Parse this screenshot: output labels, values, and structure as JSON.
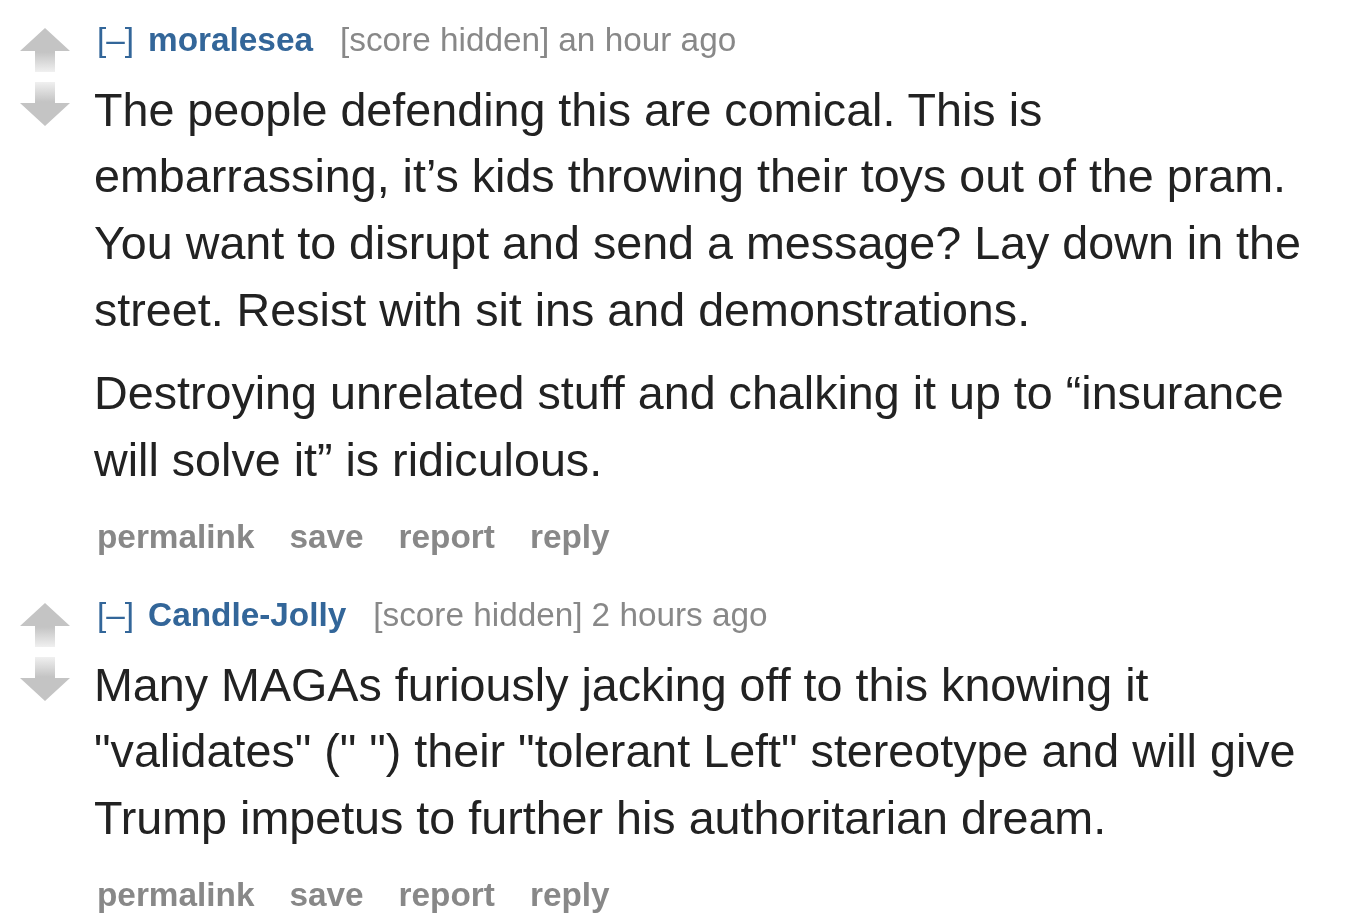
{
  "comments": [
    {
      "upvoted": false,
      "downvoted": false,
      "collapse_toggle": "[–]",
      "author": "moralesea",
      "score": "[score hidden]",
      "time": "an hour ago",
      "paragraphs": [
        "The people defending this are comical. This is embarrassing, it’s kids throwing their toys out of the pram. You want to disrupt and send a message? Lay down in the street. Resist with sit ins and demonstrations.",
        "Destroying unrelated stuff and chalking it up to “insurance will solve it” is ridiculous."
      ],
      "actions": [
        "permalink",
        "save",
        "report",
        "reply"
      ]
    },
    {
      "upvoted": false,
      "downvoted": false,
      "collapse_toggle": "[–]",
      "author": "Candle-Jolly",
      "score": "[score hidden]",
      "time": "2 hours ago",
      "paragraphs": [
        "Many MAGAs furiously jacking off to this knowing it \"validates\" (\" \") their \"tolerant Left\" stereotype and will give Trump impetus to further his authoritarian dream."
      ],
      "actions": [
        "permalink",
        "save",
        "report",
        "reply"
      ]
    }
  ]
}
